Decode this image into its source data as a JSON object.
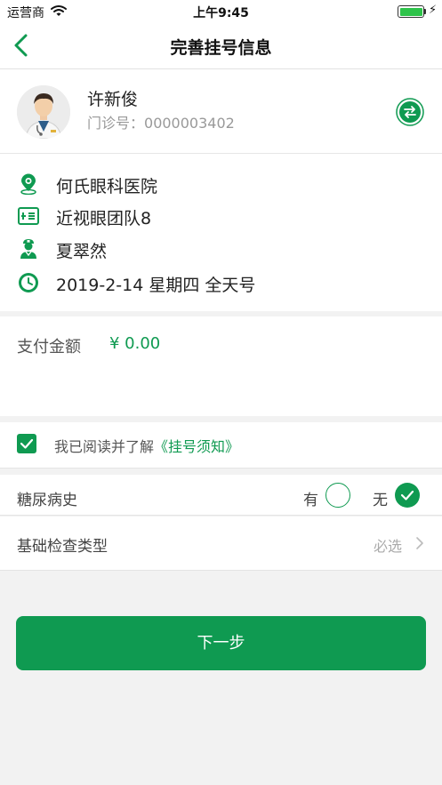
{
  "statusbar": {
    "carrier": "运营商",
    "time": "上午9:45",
    "battery_level": 1.0
  },
  "navbar": {
    "title": "完善挂号信息"
  },
  "patient": {
    "name": "许新俊",
    "clinic_label": "门诊号：",
    "clinic_no": "0000003402"
  },
  "appointment": {
    "hospital": "何氏眼科医院",
    "team": "近视眼团队8",
    "doctor": "夏翠然",
    "datetime": "2019-2-14 星期四 全天号"
  },
  "payment": {
    "label": "支付金额",
    "amount": "¥  0.00"
  },
  "agreement": {
    "checked": true,
    "prefix": "我已阅读并了解",
    "link": "《挂号须知》"
  },
  "diabetes": {
    "label": "糖尿病史",
    "yes_label": "有",
    "no_label": "无",
    "selected": "无"
  },
  "exam": {
    "label": "基础检查类型",
    "value": "必选"
  },
  "next_button": {
    "label": "下一步"
  },
  "colors": {
    "accent": "#0f9a51",
    "background": "#f2f2f2"
  }
}
